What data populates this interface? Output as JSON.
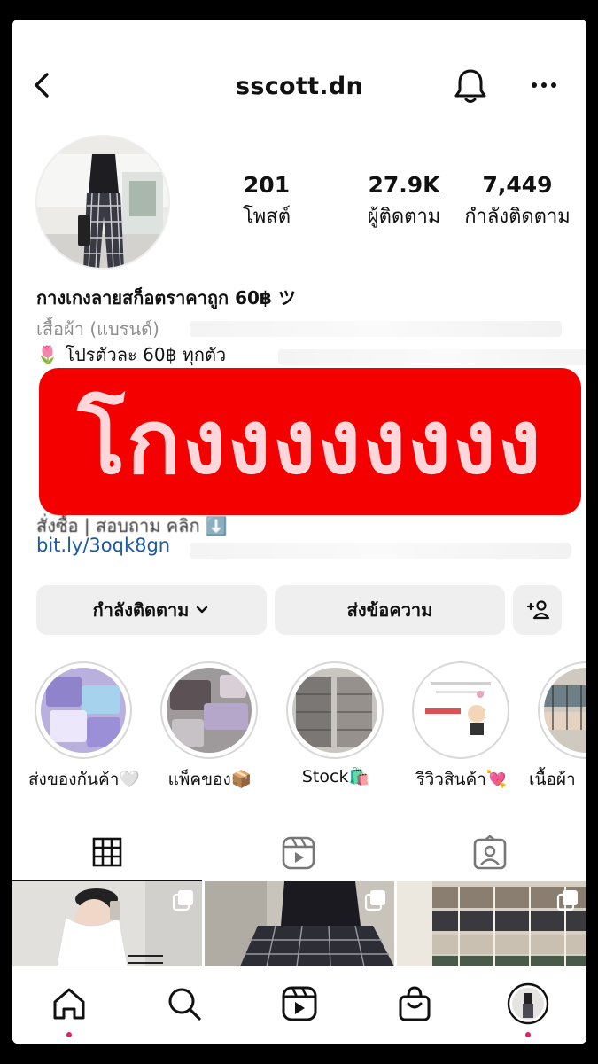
{
  "header": {
    "username": "sscott.dn",
    "back_icon": "chevron-left-icon",
    "bell_icon": "bell-icon",
    "more_icon": "more-horizontal-icon"
  },
  "stats": [
    {
      "value": "201",
      "label": "โพสต์"
    },
    {
      "value": "27.9K",
      "label": "ผู้ติดตาม"
    },
    {
      "value": "7,449",
      "label": "กำลังติดตาม"
    }
  ],
  "bio": {
    "name": "กางเกงลายสก็อตราคาถูก 60฿ ツ",
    "category": "เสื้อผ้า (แบรนด์)",
    "promo": "โปรตัวละ 60฿ ทุกตัว",
    "order_line": "สั่งซื้อ | สอบถาม คลิก ⬇️",
    "link": "bit.ly/3oqk8gn"
  },
  "overlay": {
    "text": "โกงงงงงงงง",
    "color": "#f40000"
  },
  "buttons": {
    "following": "กำลังติดตาม",
    "message": "ส่งข้อความ",
    "add_person_icon": "add-person-icon"
  },
  "highlights": [
    {
      "label": "ส่งของกันค้า🤍"
    },
    {
      "label": "แพ็คของ📦"
    },
    {
      "label": "Stock🛍️"
    },
    {
      "label": "รีวิวสินค้า💘"
    },
    {
      "label": "เนื้อผ้า"
    }
  ],
  "tabs": [
    "grid-icon",
    "reels-icon",
    "tagged-icon"
  ],
  "nav": [
    "home-icon",
    "search-icon",
    "reels-icon",
    "shop-icon",
    "profile-avatar"
  ]
}
